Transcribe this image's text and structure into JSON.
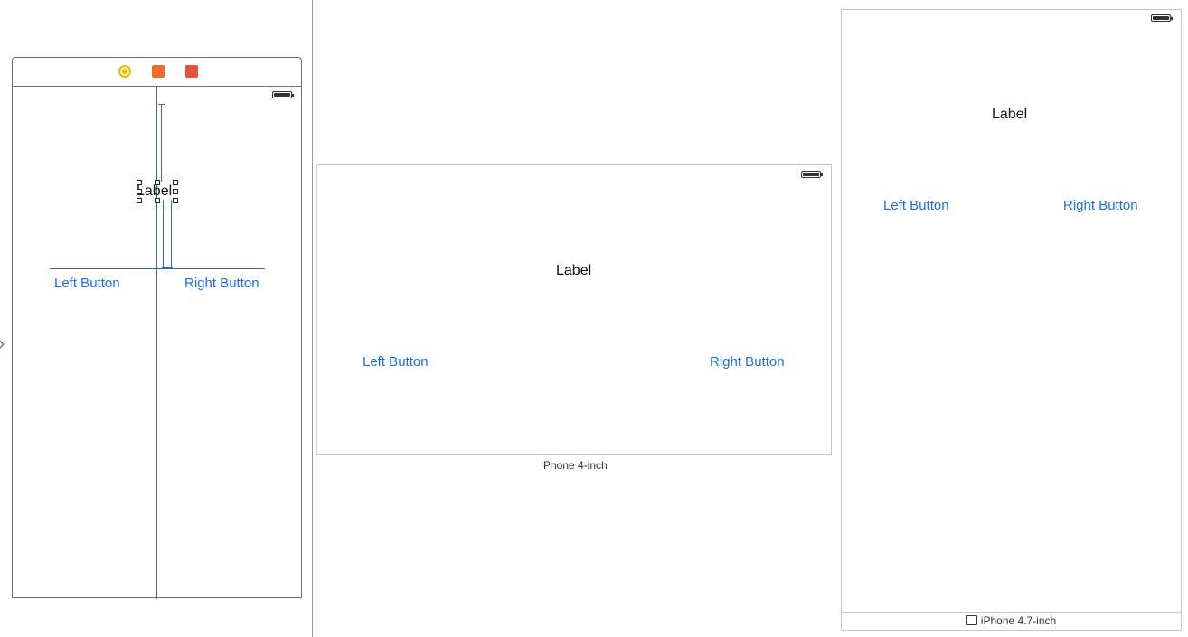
{
  "editor": {
    "label_text": "Label",
    "left_button": "Left Button",
    "right_button": "Right Button",
    "dock_icons": [
      "view-controller-icon",
      "first-responder-icon",
      "exit-icon"
    ]
  },
  "preview_4inch": {
    "label_text": "Label",
    "left_button": "Left Button",
    "right_button": "Right Button",
    "caption": "iPhone 4-inch"
  },
  "preview_47inch": {
    "label_text": "Label",
    "left_button": "Left Button",
    "right_button": "Right Button",
    "caption": "iPhone 4.7-inch",
    "caption_icon": "rotate-icon"
  },
  "colors": {
    "button_blue": "#1a6fd8",
    "constraint_blue": "#2f6da8"
  }
}
